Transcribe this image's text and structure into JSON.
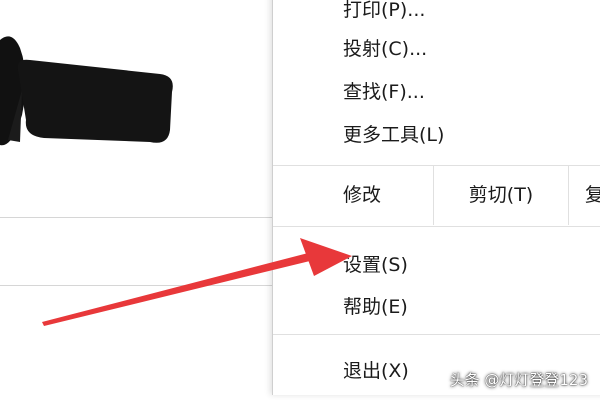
{
  "menu": {
    "items_top": [
      {
        "label": "打印(P)..."
      },
      {
        "label": "投射(C)..."
      },
      {
        "label": "查找(F)..."
      },
      {
        "label": "更多工具(L)"
      }
    ],
    "edit_row": {
      "label": "修改",
      "cut": "剪切(T)",
      "copy": "复"
    },
    "items_mid": [
      {
        "label": "设置(S)"
      },
      {
        "label": "帮助(E)"
      }
    ],
    "exit": {
      "label": "退出(X)"
    }
  },
  "annotation": {
    "arrow_color": "#e8383a"
  },
  "watermark": "头条 @灯灯登登123"
}
